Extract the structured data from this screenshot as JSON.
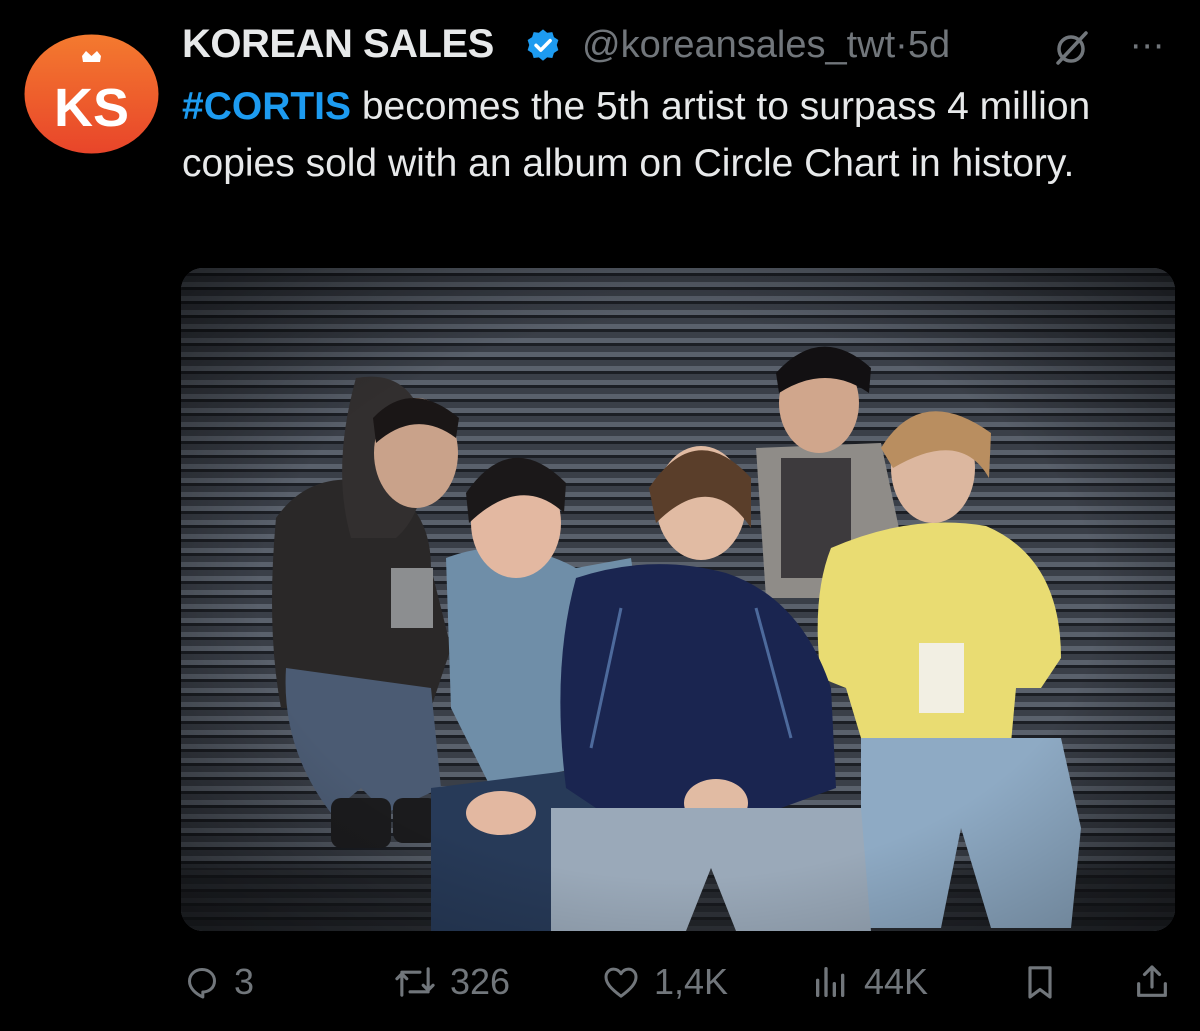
{
  "author": {
    "name": "KOREAN SALES",
    "handle": "@koreansales_twt",
    "time_separator": "·",
    "time": "5d",
    "avatar_text": "KS"
  },
  "tweet": {
    "hashtag": "#CORTIS",
    "text": " becomes the 5th artist to surpass 4 million copies sold with an album on Circle Chart in history."
  },
  "actions": {
    "replies": "3",
    "reposts": "326",
    "likes": "1,4K",
    "views": "44K"
  },
  "colors": {
    "background": "#000000",
    "text": "#e7e9ea",
    "muted": "#71767b",
    "accent": "#1d9bf0",
    "avatar": "#f05a28"
  },
  "icons": [
    "verified-badge-icon",
    "grok-icon",
    "more-icon",
    "reply-icon",
    "repost-icon",
    "like-icon",
    "views-icon",
    "bookmark-icon",
    "share-icon"
  ]
}
